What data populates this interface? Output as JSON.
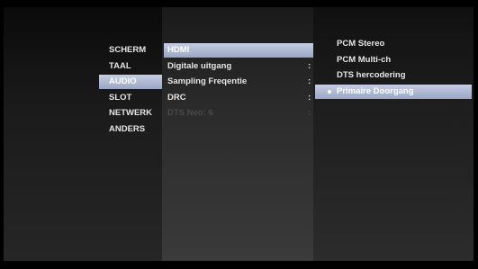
{
  "main_menu": {
    "items": [
      {
        "label": "SCHERM"
      },
      {
        "label": "TAAL"
      },
      {
        "label": "AUDIO",
        "selected": true
      },
      {
        "label": "SLOT"
      },
      {
        "label": "NETWERK"
      },
      {
        "label": "ANDERS"
      }
    ]
  },
  "audio_menu": {
    "items": [
      {
        "label": "HDMI",
        "selected": true
      },
      {
        "label": "Digitale uitgang",
        "value_sep": ":"
      },
      {
        "label": "Sampling Freqentie",
        "value_sep": ":"
      },
      {
        "label": "DRC",
        "value_sep": ":"
      },
      {
        "label": "DTS Neo: 6",
        "value_sep": ":",
        "disabled": true
      }
    ]
  },
  "hdmi_options": {
    "items": [
      {
        "label": "PCM Stereo"
      },
      {
        "label": "PCM Multi-ch"
      },
      {
        "label": "DTS hercodering"
      },
      {
        "label": "Primaire Doorgang",
        "selected": true,
        "marked": true
      }
    ]
  },
  "colors": {
    "highlight": "#9aa6c4",
    "text": "#e6e6e6",
    "disabled_text": "#4a4a4a",
    "background": "#000000"
  }
}
